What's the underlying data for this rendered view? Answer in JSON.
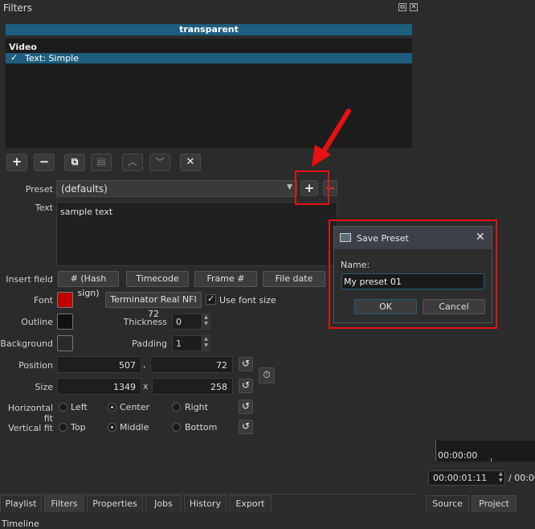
{
  "panel": {
    "title": "Filters"
  },
  "clip_title": "transparent",
  "filters_list": {
    "category": "Video",
    "items": [
      {
        "check": "✓",
        "label": "Text: Simple"
      }
    ]
  },
  "toolbar": {
    "add": "+",
    "remove": "−",
    "copy": "⧉",
    "paste": "▤",
    "up": "︿",
    "down": "﹀",
    "deselect": "✕"
  },
  "preset": {
    "label": "Preset",
    "value": "(defaults)",
    "add": "+",
    "remove": "−"
  },
  "text": {
    "label": "Text",
    "value": "sample text"
  },
  "insert_field": {
    "label": "Insert field",
    "buttons": [
      "# (Hash sign)",
      "Timecode",
      "Frame #",
      "File date"
    ]
  },
  "font": {
    "label": "Font",
    "color": "#c00000",
    "name": "Terminator Real NFI 72",
    "use_font_size_check": "✓",
    "use_font_size": "Use font size"
  },
  "outline": {
    "label": "Outline",
    "color": "#111111",
    "thickness_label": "Thickness",
    "thickness": "0"
  },
  "background": {
    "label": "Background",
    "color": "#2b2b2b",
    "padding_label": "Padding",
    "padding": "1"
  },
  "position": {
    "label": "Position",
    "x": "507",
    "sep": ",",
    "y": "72"
  },
  "size": {
    "label": "Size",
    "w": "1349",
    "sep": "x",
    "h": "258"
  },
  "horizontal_fit": {
    "label": "Horizontal fit",
    "options": [
      "Left",
      "Center",
      "Right"
    ],
    "selected": "Center"
  },
  "vertical_fit": {
    "label": "Vertical fit",
    "options": [
      "Top",
      "Middle",
      "Bottom"
    ],
    "selected": "Middle"
  },
  "dialog": {
    "title": "Save Preset",
    "close": "✕",
    "name_label": "Name:",
    "name_value": "My preset 01",
    "ok": "OK",
    "cancel": "Cancel"
  },
  "timecode": {
    "ruler": "00:00:00",
    "current": "00:00:01:11",
    "total": "/ 00:00"
  },
  "tabs": [
    "Playlist",
    "Filters",
    "Properties",
    "Jobs",
    "History",
    "Export"
  ],
  "right_tabs": [
    "Source",
    "Project"
  ],
  "bottom_label": "Timeline",
  "colors": {
    "highlight": "#1e5f80",
    "annotation": "#e81010"
  }
}
